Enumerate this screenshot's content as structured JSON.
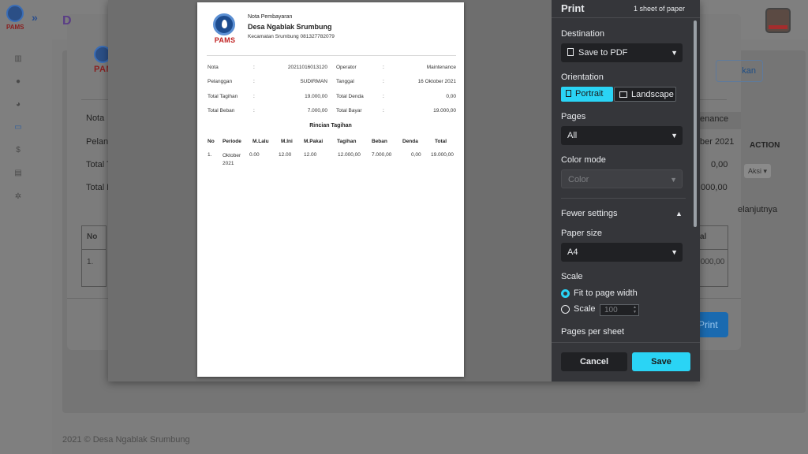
{
  "app": {
    "logo_text": "PAMS",
    "footer_year": "2021 ©",
    "footer_name": "Desa Ngablak Srumbung",
    "modal": {
      "title_letter": "D",
      "labels": [
        "Nota",
        "Pelang",
        "Total T",
        "Total B"
      ],
      "right_values": [
        "enance",
        "ber 2021",
        "0,00",
        ".000,00"
      ],
      "action_header": "ACTION",
      "aksi_label": "Aksi ▾",
      "lanjut_text": "elanjutnya",
      "kan_btn": "kan",
      "table_no_header": "No",
      "table_no_cell": "1.",
      "table_right_header": "al",
      "table_right_cell": ".000,00",
      "print_btn": "Print"
    }
  },
  "print": {
    "title": "Print",
    "sheet_count": "1 sheet of paper",
    "destination_label": "Destination",
    "destination_value": "Save to PDF",
    "orientation_label": "Orientation",
    "orientation_portrait": "Portrait",
    "orientation_landscape": "Landscape",
    "pages_label": "Pages",
    "pages_value": "All",
    "color_label": "Color mode",
    "color_value": "Color",
    "fewer_settings": "Fewer settings",
    "paper_size_label": "Paper size",
    "paper_size_value": "A4",
    "scale_label": "Scale",
    "scale_fit": "Fit to page width",
    "scale_custom": "Scale",
    "scale_value": "100",
    "pages_per_sheet_label": "Pages per sheet",
    "cancel": "Cancel",
    "save": "Save"
  },
  "document": {
    "logo_text": "PAMS",
    "header_title": "Nota Pembayaran",
    "header_name": "Desa Ngablak Srumbung",
    "header_sub": "Kecamatan Srumbung 081327782079",
    "fields_left": [
      {
        "label": "Nota",
        "value": "20211016013120"
      },
      {
        "label": "Pelanggan",
        "value": "SUDIRMAN"
      },
      {
        "label": "Total Tagihan",
        "value": "19.000,00"
      },
      {
        "label": "Total Beban",
        "value": "7.000,00"
      }
    ],
    "fields_right": [
      {
        "label": "Operator",
        "value": "Maintenance"
      },
      {
        "label": "Tanggal",
        "value": "16 Oktober 2021"
      },
      {
        "label": "Total Denda",
        "value": "0,00"
      },
      {
        "label": "Total Bayar",
        "value": "19.000,00"
      }
    ],
    "colon": ":",
    "subtitle": "Rincian Tagihan",
    "columns": [
      "No",
      "Periode",
      "M.Lalu",
      "M.Ini",
      "M.Pakai",
      "Tagihan",
      "Beban",
      "Denda",
      "Total"
    ],
    "rows": [
      [
        "1.",
        "Oktober 2021",
        "0.00",
        "12.00",
        "12.00",
        "12.000,00",
        "7.000,00",
        "0,00",
        "19.000,00"
      ]
    ]
  }
}
